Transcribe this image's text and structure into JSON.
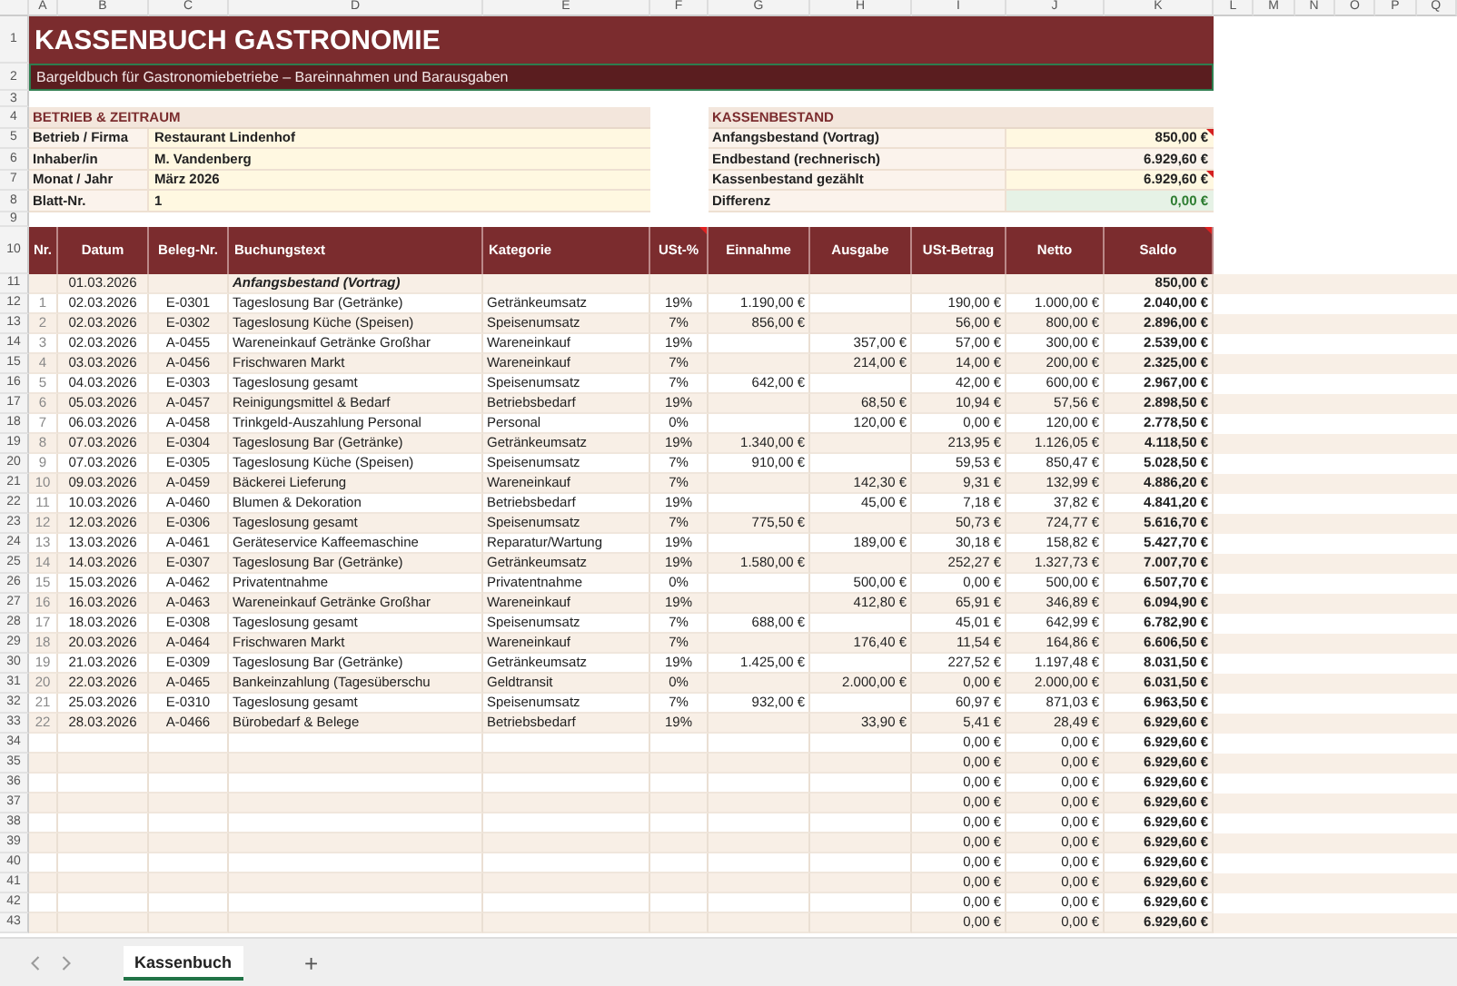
{
  "column_letters": [
    "A",
    "B",
    "C",
    "D",
    "E",
    "F",
    "G",
    "H",
    "I",
    "J",
    "K",
    "L",
    "M",
    "N",
    "O",
    "P",
    "Q"
  ],
  "row_numbers": [
    "1",
    "2",
    "3",
    "4",
    "5",
    "6",
    "7",
    "8",
    "9",
    "10",
    "11",
    "12",
    "13",
    "14",
    "15",
    "16",
    "17",
    "18",
    "19",
    "20",
    "21",
    "22",
    "23",
    "24",
    "25",
    "26",
    "27",
    "28",
    "29",
    "30",
    "31",
    "32",
    "33",
    "34",
    "35",
    "36",
    "37",
    "38",
    "39",
    "40",
    "41",
    "42",
    "43"
  ],
  "title": "KASSENBUCH GASTRONOMIE",
  "subtitle": {
    "text": "Bargeldbuch für Gastronomiebetriebe – Bareinnahmen und Barausgaben",
    "selected": true
  },
  "info_section": {
    "heading": "BETRIEB & ZEITRAUM",
    "rows": [
      {
        "label": "Betrieb / Firma",
        "value": "Restaurant Lindenhof"
      },
      {
        "label": "Inhaber/in",
        "value": "M. Vandenberg"
      },
      {
        "label": "Monat / Jahr",
        "value": "März 2026"
      },
      {
        "label": "Blatt-Nr.",
        "value": "1"
      }
    ]
  },
  "cash_section": {
    "heading": "KASSENBESTAND",
    "rows": [
      {
        "label": "Anfangsbestand (Vortrag)",
        "value": "850,00 €",
        "kind": "input",
        "has_note": true
      },
      {
        "label": "Endbestand (rechnerisch)",
        "value": "6.929,60 €",
        "kind": "calc",
        "has_note": false
      },
      {
        "label": "Kassenbestand gezählt",
        "value": "6.929,60 €",
        "kind": "input",
        "has_note": true
      },
      {
        "label": "Differenz",
        "value": "0,00 €",
        "kind": "check",
        "has_note": false
      }
    ]
  },
  "table": {
    "columns": [
      {
        "label": "Nr.",
        "has_note": false
      },
      {
        "label": "Datum",
        "has_note": false
      },
      {
        "label": "Beleg-Nr.",
        "has_note": false
      },
      {
        "label": "Buchungstext",
        "has_note": false
      },
      {
        "label": "Kategorie",
        "has_note": false
      },
      {
        "label": "USt-%",
        "has_note": true
      },
      {
        "label": "Einnahme",
        "has_note": false
      },
      {
        "label": "Ausgabe",
        "has_note": false
      },
      {
        "label": "USt-Betrag",
        "has_note": false
      },
      {
        "label": "Netto",
        "has_note": false
      },
      {
        "label": "Saldo",
        "has_note": true
      }
    ],
    "opening": {
      "date": "01.03.2026",
      "text": "Anfangsbestand (Vortrag)",
      "balance": "850,00 €"
    },
    "rows": [
      {
        "nr": "1",
        "date": "02.03.2026",
        "receipt": "E-0301",
        "text": "Tageslosung Bar (Getränke)",
        "category": "Getränkeumsatz",
        "vat": "19%",
        "income": "1.190,00 €",
        "expense": "",
        "vat_amount": "190,00 €",
        "net": "1.000,00 €",
        "balance": "2.040,00 €"
      },
      {
        "nr": "2",
        "date": "02.03.2026",
        "receipt": "E-0302",
        "text": "Tageslosung Küche (Speisen)",
        "category": "Speisenumsatz",
        "vat": "7%",
        "income": "856,00 €",
        "expense": "",
        "vat_amount": "56,00 €",
        "net": "800,00 €",
        "balance": "2.896,00 €"
      },
      {
        "nr": "3",
        "date": "02.03.2026",
        "receipt": "A-0455",
        "text": "Wareneinkauf Getränke Großhar",
        "category": "Wareneinkauf",
        "vat": "19%",
        "income": "",
        "expense": "357,00 €",
        "vat_amount": "57,00 €",
        "net": "300,00 €",
        "balance": "2.539,00 €"
      },
      {
        "nr": "4",
        "date": "03.03.2026",
        "receipt": "A-0456",
        "text": "Frischwaren Markt",
        "category": "Wareneinkauf",
        "vat": "7%",
        "income": "",
        "expense": "214,00 €",
        "vat_amount": "14,00 €",
        "net": "200,00 €",
        "balance": "2.325,00 €"
      },
      {
        "nr": "5",
        "date": "04.03.2026",
        "receipt": "E-0303",
        "text": "Tageslosung gesamt",
        "category": "Speisenumsatz",
        "vat": "7%",
        "income": "642,00 €",
        "expense": "",
        "vat_amount": "42,00 €",
        "net": "600,00 €",
        "balance": "2.967,00 €"
      },
      {
        "nr": "6",
        "date": "05.03.2026",
        "receipt": "A-0457",
        "text": "Reinigungsmittel & Bedarf",
        "category": "Betriebsbedarf",
        "vat": "19%",
        "income": "",
        "expense": "68,50 €",
        "vat_amount": "10,94 €",
        "net": "57,56 €",
        "balance": "2.898,50 €"
      },
      {
        "nr": "7",
        "date": "06.03.2026",
        "receipt": "A-0458",
        "text": "Trinkgeld-Auszahlung Personal",
        "category": "Personal",
        "vat": "0%",
        "income": "",
        "expense": "120,00 €",
        "vat_amount": "0,00 €",
        "net": "120,00 €",
        "balance": "2.778,50 €"
      },
      {
        "nr": "8",
        "date": "07.03.2026",
        "receipt": "E-0304",
        "text": "Tageslosung Bar (Getränke)",
        "category": "Getränkeumsatz",
        "vat": "19%",
        "income": "1.340,00 €",
        "expense": "",
        "vat_amount": "213,95 €",
        "net": "1.126,05 €",
        "balance": "4.118,50 €"
      },
      {
        "nr": "9",
        "date": "07.03.2026",
        "receipt": "E-0305",
        "text": "Tageslosung Küche (Speisen)",
        "category": "Speisenumsatz",
        "vat": "7%",
        "income": "910,00 €",
        "expense": "",
        "vat_amount": "59,53 €",
        "net": "850,47 €",
        "balance": "5.028,50 €"
      },
      {
        "nr": "10",
        "date": "09.03.2026",
        "receipt": "A-0459",
        "text": "Bäckerei Lieferung",
        "category": "Wareneinkauf",
        "vat": "7%",
        "income": "",
        "expense": "142,30 €",
        "vat_amount": "9,31 €",
        "net": "132,99 €",
        "balance": "4.886,20 €"
      },
      {
        "nr": "11",
        "date": "10.03.2026",
        "receipt": "A-0460",
        "text": "Blumen & Dekoration",
        "category": "Betriebsbedarf",
        "vat": "19%",
        "income": "",
        "expense": "45,00 €",
        "vat_amount": "7,18 €",
        "net": "37,82 €",
        "balance": "4.841,20 €"
      },
      {
        "nr": "12",
        "date": "12.03.2026",
        "receipt": "E-0306",
        "text": "Tageslosung gesamt",
        "category": "Speisenumsatz",
        "vat": "7%",
        "income": "775,50 €",
        "expense": "",
        "vat_amount": "50,73 €",
        "net": "724,77 €",
        "balance": "5.616,70 €"
      },
      {
        "nr": "13",
        "date": "13.03.2026",
        "receipt": "A-0461",
        "text": "Geräteservice Kaffeemaschine",
        "category": "Reparatur/Wartung",
        "vat": "19%",
        "income": "",
        "expense": "189,00 €",
        "vat_amount": "30,18 €",
        "net": "158,82 €",
        "balance": "5.427,70 €"
      },
      {
        "nr": "14",
        "date": "14.03.2026",
        "receipt": "E-0307",
        "text": "Tageslosung Bar (Getränke)",
        "category": "Getränkeumsatz",
        "vat": "19%",
        "income": "1.580,00 €",
        "expense": "",
        "vat_amount": "252,27 €",
        "net": "1.327,73 €",
        "balance": "7.007,70 €"
      },
      {
        "nr": "15",
        "date": "15.03.2026",
        "receipt": "A-0462",
        "text": "Privatentnahme",
        "category": "Privatentnahme",
        "vat": "0%",
        "income": "",
        "expense": "500,00 €",
        "vat_amount": "0,00 €",
        "net": "500,00 €",
        "balance": "6.507,70 €"
      },
      {
        "nr": "16",
        "date": "16.03.2026",
        "receipt": "A-0463",
        "text": "Wareneinkauf Getränke Großhar",
        "category": "Wareneinkauf",
        "vat": "19%",
        "income": "",
        "expense": "412,80 €",
        "vat_amount": "65,91 €",
        "net": "346,89 €",
        "balance": "6.094,90 €"
      },
      {
        "nr": "17",
        "date": "18.03.2026",
        "receipt": "E-0308",
        "text": "Tageslosung gesamt",
        "category": "Speisenumsatz",
        "vat": "7%",
        "income": "688,00 €",
        "expense": "",
        "vat_amount": "45,01 €",
        "net": "642,99 €",
        "balance": "6.782,90 €"
      },
      {
        "nr": "18",
        "date": "20.03.2026",
        "receipt": "A-0464",
        "text": "Frischwaren Markt",
        "category": "Wareneinkauf",
        "vat": "7%",
        "income": "",
        "expense": "176,40 €",
        "vat_amount": "11,54 €",
        "net": "164,86 €",
        "balance": "6.606,50 €"
      },
      {
        "nr": "19",
        "date": "21.03.2026",
        "receipt": "E-0309",
        "text": "Tageslosung Bar (Getränke)",
        "category": "Getränkeumsatz",
        "vat": "19%",
        "income": "1.425,00 €",
        "expense": "",
        "vat_amount": "227,52 €",
        "net": "1.197,48 €",
        "balance": "8.031,50 €"
      },
      {
        "nr": "20",
        "date": "22.03.2026",
        "receipt": "A-0465",
        "text": "Bankeinzahlung (Tagesüberschu",
        "category": "Geldtransit",
        "vat": "0%",
        "income": "",
        "expense": "2.000,00 €",
        "vat_amount": "0,00 €",
        "net": "2.000,00 €",
        "balance": "6.031,50 €"
      },
      {
        "nr": "21",
        "date": "25.03.2026",
        "receipt": "E-0310",
        "text": "Tageslosung gesamt",
        "category": "Speisenumsatz",
        "vat": "7%",
        "income": "932,00 €",
        "expense": "",
        "vat_amount": "60,97 €",
        "net": "871,03 €",
        "balance": "6.963,50 €"
      },
      {
        "nr": "22",
        "date": "28.03.2026",
        "receipt": "A-0466",
        "text": "Bürobedarf & Belege",
        "category": "Betriebsbedarf",
        "vat": "19%",
        "income": "",
        "expense": "33,90 €",
        "vat_amount": "5,41 €",
        "net": "28,49 €",
        "balance": "6.929,60 €"
      },
      {
        "nr": "",
        "date": "",
        "receipt": "",
        "text": "",
        "category": "",
        "vat": "",
        "income": "",
        "expense": "",
        "vat_amount": "0,00 €",
        "net": "0,00 €",
        "balance": "6.929,60 €"
      },
      {
        "nr": "",
        "date": "",
        "receipt": "",
        "text": "",
        "category": "",
        "vat": "",
        "income": "",
        "expense": "",
        "vat_amount": "0,00 €",
        "net": "0,00 €",
        "balance": "6.929,60 €"
      },
      {
        "nr": "",
        "date": "",
        "receipt": "",
        "text": "",
        "category": "",
        "vat": "",
        "income": "",
        "expense": "",
        "vat_amount": "0,00 €",
        "net": "0,00 €",
        "balance": "6.929,60 €"
      },
      {
        "nr": "",
        "date": "",
        "receipt": "",
        "text": "",
        "category": "",
        "vat": "",
        "income": "",
        "expense": "",
        "vat_amount": "0,00 €",
        "net": "0,00 €",
        "balance": "6.929,60 €"
      },
      {
        "nr": "",
        "date": "",
        "receipt": "",
        "text": "",
        "category": "",
        "vat": "",
        "income": "",
        "expense": "",
        "vat_amount": "0,00 €",
        "net": "0,00 €",
        "balance": "6.929,60 €"
      },
      {
        "nr": "",
        "date": "",
        "receipt": "",
        "text": "",
        "category": "",
        "vat": "",
        "income": "",
        "expense": "",
        "vat_amount": "0,00 €",
        "net": "0,00 €",
        "balance": "6.929,60 €"
      },
      {
        "nr": "",
        "date": "",
        "receipt": "",
        "text": "",
        "category": "",
        "vat": "",
        "income": "",
        "expense": "",
        "vat_amount": "0,00 €",
        "net": "0,00 €",
        "balance": "6.929,60 €"
      },
      {
        "nr": "",
        "date": "",
        "receipt": "",
        "text": "",
        "category": "",
        "vat": "",
        "income": "",
        "expense": "",
        "vat_amount": "0,00 €",
        "net": "0,00 €",
        "balance": "6.929,60 €"
      },
      {
        "nr": "",
        "date": "",
        "receipt": "",
        "text": "",
        "category": "",
        "vat": "",
        "income": "",
        "expense": "",
        "vat_amount": "0,00 €",
        "net": "0,00 €",
        "balance": "6.929,60 €"
      },
      {
        "nr": "",
        "date": "",
        "receipt": "",
        "text": "",
        "category": "",
        "vat": "",
        "income": "",
        "expense": "",
        "vat_amount": "0,00 €",
        "net": "0,00 €",
        "balance": "6.929,60 €"
      }
    ]
  },
  "sheet_tabs": [
    {
      "label": "Kassenbuch",
      "selected": true
    }
  ],
  "add_sheet": "+"
}
